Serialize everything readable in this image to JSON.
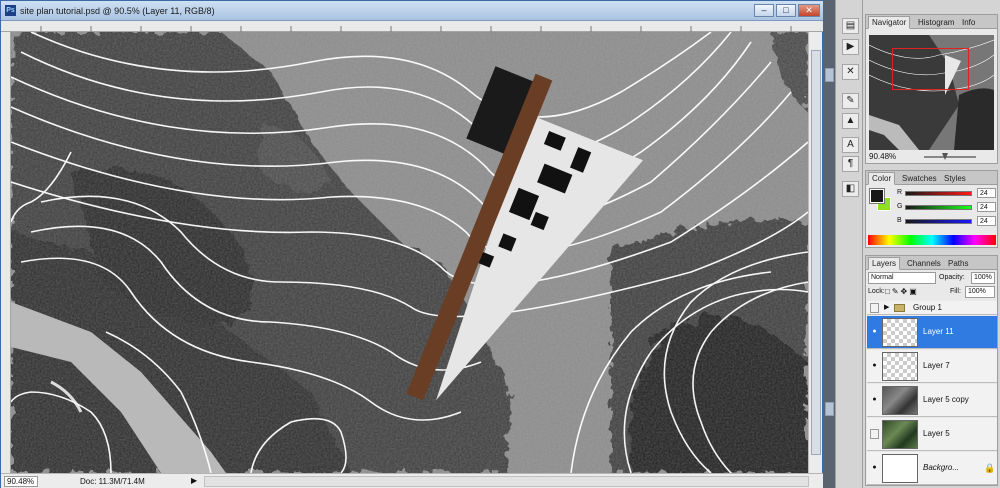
{
  "window": {
    "title": "site plan tutorial.psd @ 90.5% (Layer 11, RGB/8)",
    "app_icon": "Ps",
    "buttons": {
      "minimize": "–",
      "maximize": "□",
      "close": "✕"
    }
  },
  "status": {
    "zoom": "90.48%",
    "doc": "Doc: 11.3M/71.4M",
    "arrow": "▶"
  },
  "navigator": {
    "tabs": [
      "Navigator",
      "Histogram",
      "Info"
    ],
    "zoom": "90.48%",
    "viewbox_color": "#e42020"
  },
  "color_panel": {
    "tabs": [
      "Color",
      "Swatches",
      "Styles"
    ],
    "foreground": "#181818",
    "background": "#8ee021",
    "channels": [
      {
        "label": "R",
        "value": "24"
      },
      {
        "label": "G",
        "value": "24"
      },
      {
        "label": "B",
        "value": "24"
      }
    ]
  },
  "layers_panel": {
    "tabs": [
      "Layers",
      "Channels",
      "Paths"
    ],
    "blend_mode": "Normal",
    "opacity_label": "Opacity:",
    "opacity": "100%",
    "lock_label": "Lock:",
    "fill_label": "Fill:",
    "fill": "100%",
    "layers": [
      {
        "name": "Group 1",
        "visible": false,
        "selected": false,
        "kind": "group"
      },
      {
        "name": "Layer 11",
        "visible": true,
        "selected": true,
        "kind": "transparent"
      },
      {
        "name": "Layer 7",
        "visible": true,
        "selected": false,
        "kind": "transparent"
      },
      {
        "name": "Layer 5 copy",
        "visible": true,
        "selected": false,
        "kind": "aerial-gray"
      },
      {
        "name": "Layer 5",
        "visible": false,
        "selected": false,
        "kind": "aerial-green"
      },
      {
        "name": "Backgro...",
        "visible": true,
        "selected": false,
        "kind": "white"
      }
    ]
  },
  "tools": [
    "history-icon",
    "actions-icon",
    "tools-icon",
    "brush-icon",
    "stamp-icon",
    "character-icon",
    "paragraph-icon",
    "layer-comps-icon"
  ],
  "accent": "#2f7be1"
}
